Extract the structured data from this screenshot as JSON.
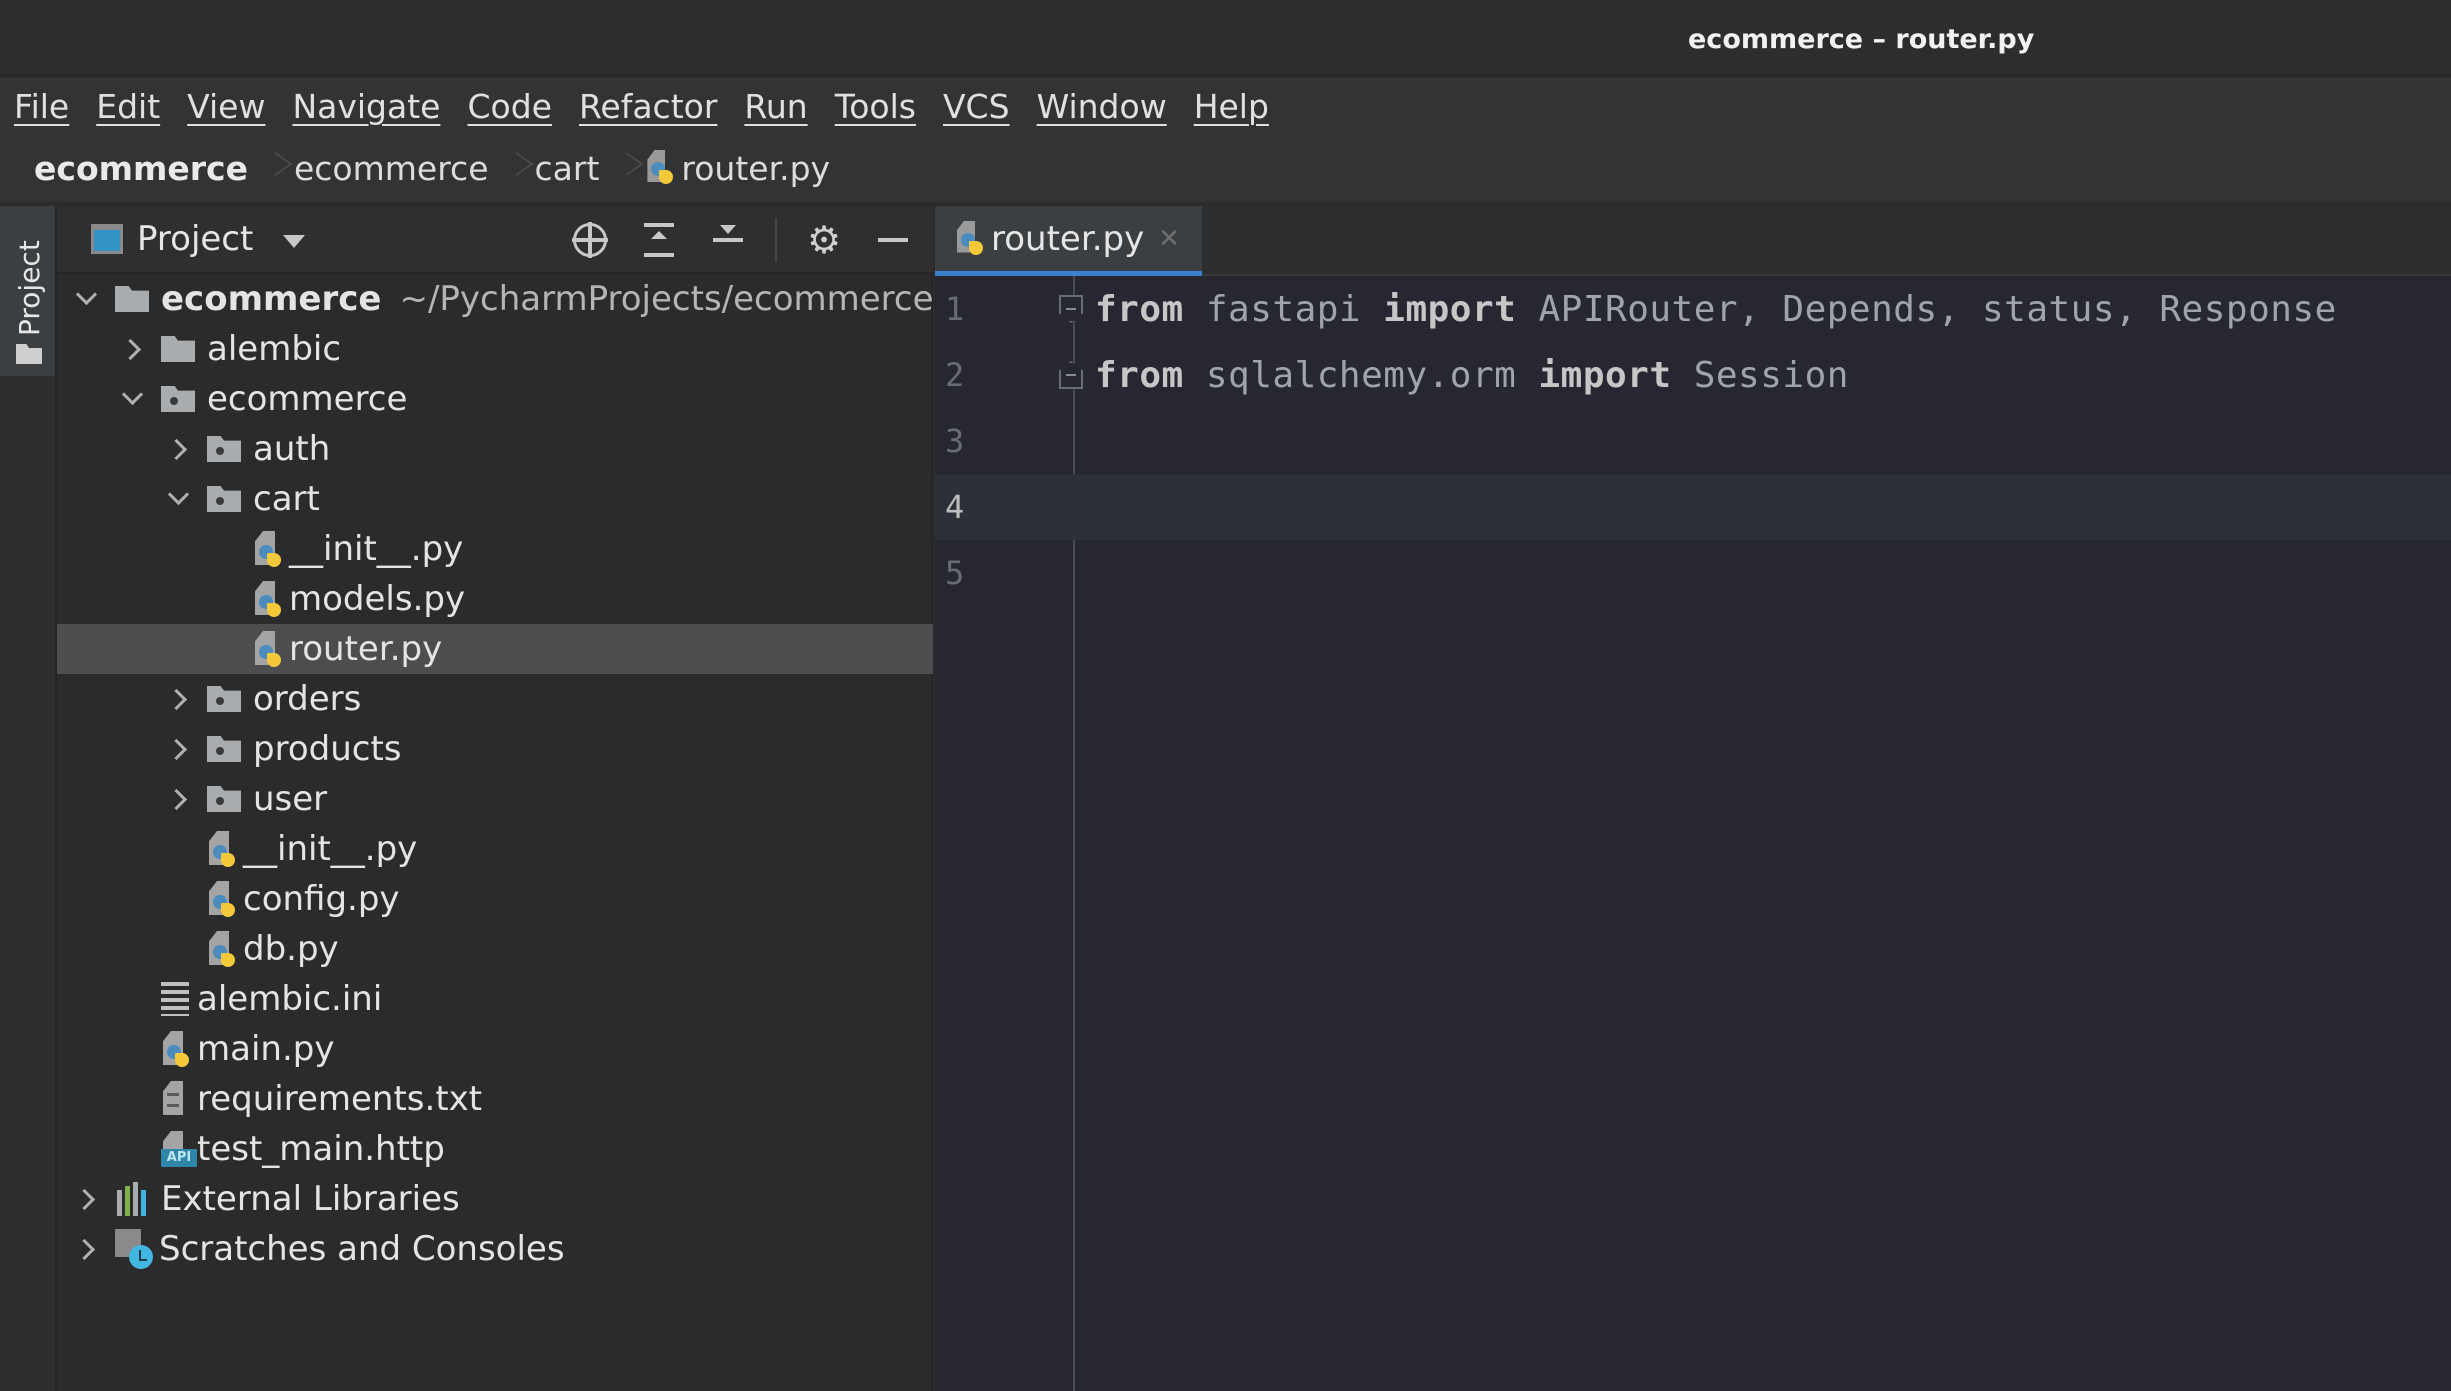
{
  "window": {
    "title": "ecommerce – router.py"
  },
  "menu": [
    "File",
    "Edit",
    "View",
    "Navigate",
    "Code",
    "Refactor",
    "Run",
    "Tools",
    "VCS",
    "Window",
    "Help"
  ],
  "breadcrumb": {
    "items": [
      "ecommerce",
      "ecommerce",
      "cart",
      "router.py"
    ]
  },
  "left_strip": {
    "project_tab_label": "Project"
  },
  "project_panel": {
    "title": "Project",
    "tools": [
      "locate-icon",
      "expand-all-icon",
      "collapse-all-icon",
      "gear-icon",
      "minimize-icon"
    ],
    "tree": [
      {
        "label": "ecommerce",
        "sub": "~/PycharmProjects/ecommerce",
        "type": "folder",
        "depth": 0,
        "expanded": true,
        "bold": true
      },
      {
        "label": "alembic",
        "type": "folder",
        "depth": 1,
        "expanded": false
      },
      {
        "label": "ecommerce",
        "type": "package",
        "depth": 1,
        "expanded": true
      },
      {
        "label": "auth",
        "type": "package",
        "depth": 2,
        "expanded": false
      },
      {
        "label": "cart",
        "type": "package",
        "depth": 2,
        "expanded": true
      },
      {
        "label": "__init__.py",
        "type": "python",
        "depth": 3
      },
      {
        "label": "models.py",
        "type": "python",
        "depth": 3
      },
      {
        "label": "router.py",
        "type": "python",
        "depth": 3,
        "selected": true
      },
      {
        "label": "orders",
        "type": "package",
        "depth": 2,
        "expanded": false
      },
      {
        "label": "products",
        "type": "package",
        "depth": 2,
        "expanded": false
      },
      {
        "label": "user",
        "type": "package",
        "depth": 2,
        "expanded": false
      },
      {
        "label": "__init__.py",
        "type": "python",
        "depth": 2
      },
      {
        "label": "config.py",
        "type": "python",
        "depth": 2
      },
      {
        "label": "db.py",
        "type": "python",
        "depth": 2
      },
      {
        "label": "alembic.ini",
        "type": "ini",
        "depth": 1
      },
      {
        "label": "main.py",
        "type": "python",
        "depth": 1
      },
      {
        "label": "requirements.txt",
        "type": "text",
        "depth": 1
      },
      {
        "label": "test_main.http",
        "type": "http",
        "depth": 1
      },
      {
        "label": "External Libraries",
        "type": "libraries",
        "depth": 0,
        "expanded": false
      },
      {
        "label": "Scratches and Consoles",
        "type": "scratches",
        "depth": 0,
        "expanded": false
      }
    ]
  },
  "editor": {
    "tabs": [
      {
        "label": "router.py",
        "active": true
      }
    ],
    "current_line": 4,
    "lines": [
      {
        "num": "1",
        "tokens": [
          {
            "t": "from",
            "k": "kw"
          },
          {
            "t": " fastapi ",
            "k": "ident"
          },
          {
            "t": "import",
            "k": "kw"
          },
          {
            "t": " APIRouter, Depends, status, Response",
            "k": "ident"
          }
        ],
        "fold": "open"
      },
      {
        "num": "2",
        "tokens": [
          {
            "t": "from",
            "k": "kw"
          },
          {
            "t": " sqlalchemy.orm ",
            "k": "ident"
          },
          {
            "t": "import",
            "k": "kw"
          },
          {
            "t": " Session",
            "k": "ident"
          }
        ],
        "fold": "close"
      },
      {
        "num": "3",
        "tokens": []
      },
      {
        "num": "4",
        "tokens": []
      },
      {
        "num": "5",
        "tokens": []
      }
    ]
  },
  "colors": {
    "accent_tab_underline": "#3b7fcf",
    "python_blue": "#4b8bbe",
    "python_yellow": "#f3c93a",
    "scratches_clock": "#40b6e0",
    "selected_row": "#4b4d4f"
  }
}
